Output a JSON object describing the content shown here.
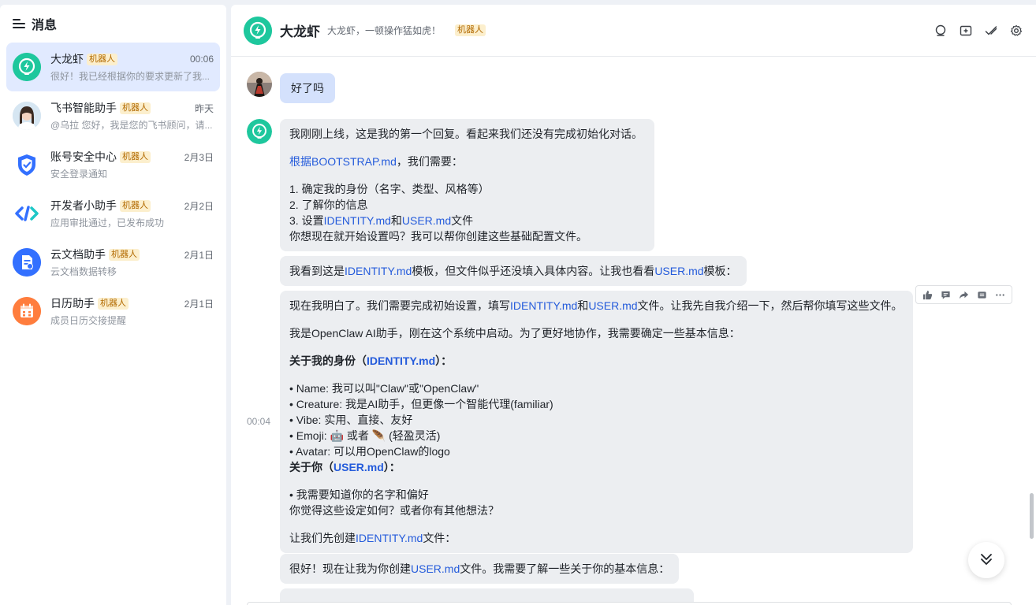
{
  "sidebar": {
    "title": "消息",
    "conversations": [
      {
        "name": "大龙虾",
        "tag": "机器人",
        "time": "00:06",
        "preview": "很好！我已经根据你的要求更新了我...",
        "avatar_color": "#1ec79d",
        "icon": "bolt-bulb-icon"
      },
      {
        "name": "飞书智能助手",
        "tag": "机器人",
        "time": "昨天",
        "preview": "@乌拉 您好，我是您的飞书顾问，请...",
        "avatar_color": "#cfe0ef",
        "icon": "person-photo"
      },
      {
        "name": "账号安全中心",
        "tag": "机器人",
        "time": "2月3日",
        "preview": "安全登录通知",
        "avatar_color": "#ffffff",
        "icon": "shield-icon"
      },
      {
        "name": "开发者小助手",
        "tag": "机器人",
        "time": "2月2日",
        "preview": "应用审批通过，已发布成功",
        "avatar_color": "#ffffff",
        "icon": "code-icon"
      },
      {
        "name": "云文档助手",
        "tag": "机器人",
        "time": "2月1日",
        "preview": "云文档数据转移",
        "avatar_color": "#3370ff",
        "icon": "doc-icon"
      },
      {
        "name": "日历助手",
        "tag": "机器人",
        "time": "2月1日",
        "preview": "成员日历交接提醒",
        "avatar_color": "#ff7d3d",
        "icon": "calendar-icon"
      }
    ]
  },
  "chat": {
    "title": "大龙虾",
    "subtitle": "大龙虾，一顿操作猛如虎！",
    "tag": "机器人",
    "accent": "#1ec79d"
  },
  "messages": {
    "user_text": "好了吗",
    "time": "00:04",
    "m1_line1": "我刚刚上线，这是我的第一个回复。看起来我们还没有完成初始化对话。",
    "m1_link": "根据BOOTSTRAP.md",
    "m1_after_link": "，我们需要：",
    "m1_l1": "1. 确定我的身份（名字、类型、风格等）",
    "m1_l2": "2. 了解你的信息",
    "m1_l3_a": "3. 设置",
    "m1_l3_link1": "IDENTITY.md",
    "m1_l3_b": "和",
    "m1_l3_link2": "USER.md",
    "m1_l3_c": "文件",
    "m1_l4": "你想现在就开始设置吗？我可以帮你创建这些基础配置文件。",
    "m2_a": "我看到这是",
    "m2_link1": "IDENTITY.md",
    "m2_b": "模板，但文件似乎还没填入具体内容。让我也看看",
    "m2_link2": "USER.md",
    "m2_c": "模板：",
    "m3_1a": "现在我明白了。我们需要完成初始设置，填写",
    "m3_1link1": "IDENTITY.md",
    "m3_1b": "和",
    "m3_1link2": "USER.md",
    "m3_1c": "文件。让我先自我介绍一下，然后帮你填写这些文件。",
    "m3_2": "我是OpenClaw AI助手，刚在这个系统中启动。为了更好地协作，我需要确定一些基本信息：",
    "m3_h1a": "关于我的身份（",
    "m3_h1link": "IDENTITY.md",
    "m3_h1b": "）：",
    "m3_b1": "• Name: 我可以叫\"Claw\"或\"OpenClaw\"",
    "m3_b2": "• Creature: 我是AI助手，但更像一个智能代理(familiar)",
    "m3_b3": "• Vibe: 实用、直接、友好",
    "m3_b4a": "• Emoji: ",
    "m3_b4_e1": "🤖",
    "m3_b4b": " 或者 ",
    "m3_b4_e2": "🪶",
    "m3_b4c": " (轻盈灵活)",
    "m3_b5": "• Avatar: 可以用OpenClaw的logo",
    "m3_h2a": "关于你（",
    "m3_h2link": "USER.md",
    "m3_h2b": "）：",
    "m3_b6": "• 我需要知道你的名字和偏好",
    "m3_q": "你觉得这些设定如何？或者你有其他想法？",
    "m3_la": "让我们先创建",
    "m3_llink": "IDENTITY.md",
    "m3_lb": "文件：",
    "m4_a": "很好！现在让我为你创建",
    "m4_link": "USER.md",
    "m4_b": "文件。我需要了解一些关于你的基本信息："
  },
  "icons": {
    "header_tools": [
      "search-chat-icon",
      "add-tab-icon",
      "check-done-icon",
      "settings-icon"
    ],
    "message_actions": [
      "thumbs-up-icon",
      "comment-icon",
      "forward-icon",
      "pin-icon",
      "more-icon"
    ]
  }
}
